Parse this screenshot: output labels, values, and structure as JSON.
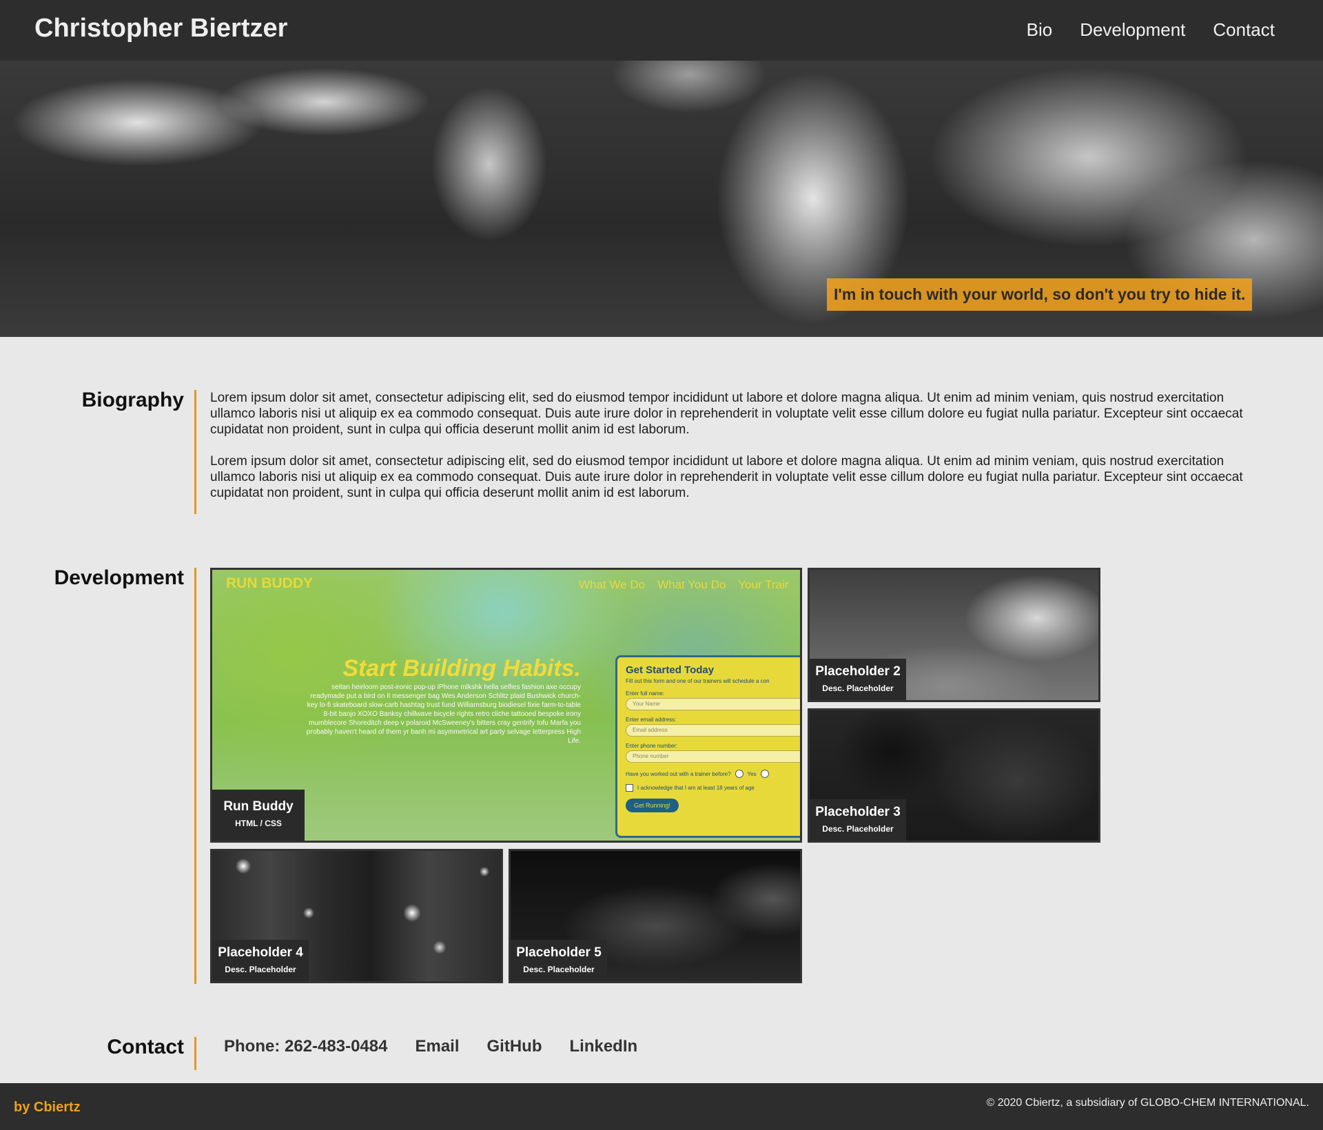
{
  "header": {
    "title": "Christopher Biertzer",
    "nav": [
      "Bio",
      "Development",
      "Contact"
    ]
  },
  "hero": {
    "tagline": "I'm in touch with your world, so don't you try to hide it."
  },
  "biography": {
    "heading": "Biography",
    "paragraphs": [
      "Lorem ipsum dolor sit amet, consectetur adipiscing elit, sed do eiusmod tempor incididunt ut labore et dolore magna aliqua. Ut enim ad minim veniam, quis nostrud exercitation ullamco laboris nisi ut aliquip ex ea commodo consequat. Duis aute irure dolor in reprehenderit in voluptate velit esse cillum dolore eu fugiat nulla pariatur. Excepteur sint occaecat cupidatat non proident, sunt in culpa qui officia deserunt mollit anim id est laborum.",
      "Lorem ipsum dolor sit amet, consectetur adipiscing elit, sed do eiusmod tempor incididunt ut labore et dolore magna aliqua. Ut enim ad minim veniam, quis nostrud exercitation ullamco laboris nisi ut aliquip ex ea commodo consequat. Duis aute irure dolor in reprehenderit in voluptate velit esse cillum dolore eu fugiat nulla pariatur. Excepteur sint occaecat cupidatat non proident, sunt in culpa qui officia deserunt mollit anim id est laborum."
    ]
  },
  "development": {
    "heading": "Development",
    "featured": {
      "title": "Run Buddy",
      "desc": "HTML / CSS",
      "preview": {
        "logo": "RUN BUDDY",
        "nav": [
          "What We Do",
          "What You Do",
          "Your Trair"
        ],
        "headline": "Start Building Habits.",
        "copy": "seitan heirloom post-ironic pop-up iPhone mlkshk hella selfies fashion axe occupy readymade put a bird on it messenger bag Wes Anderson Schlitz plaid Bushwick church-key lo-fi skateboard slow-carb hashtag trust fund Williamsburg biodiesel fixie farm-to-table 8-bit banjo XOXO Banksy chillwave bicycle rights retro cliche tattooed bespoke irony mumblecore Shoreditch deep v polaroid McSweeney's bitters cray gentrify tofu Marfa you probably haven't heard of them yr banh mi asymmetrical art party selvage letterpress High Life.",
        "form_title": "Get Started Today",
        "form_sub": "Fill out this form and one of our trainers will schedule a con",
        "name_label": "Enter full name:",
        "name_placeholder": "Your Name",
        "email_label": "Enter email address:",
        "email_placeholder": "Email address",
        "phone_label": "Enter phone number:",
        "phone_placeholder": "Phone number",
        "question": "Have you worked out with a trainer before?",
        "yes": "Yes",
        "ack": "I acknowledge that I am at least 18 years of age",
        "button": "Get Running!"
      }
    },
    "placeholders": [
      {
        "title": "Placeholder 2",
        "desc": "Desc. Placeholder"
      },
      {
        "title": "Placeholder 3",
        "desc": "Desc. Placeholder"
      },
      {
        "title": "Placeholder 4",
        "desc": "Desc. Placeholder"
      },
      {
        "title": "Placeholder 5",
        "desc": "Desc. Placeholder"
      }
    ]
  },
  "contact": {
    "heading": "Contact",
    "phone": "Phone: 262-483-0484",
    "links": [
      "Email",
      "GitHub",
      "LinkedIn"
    ]
  },
  "footer": {
    "by": "by Cbiertz",
    "copyright": "© 2020 Cbiertz, a subsidiary of GLOBO-CHEM INTERNATIONAL."
  },
  "colors": {
    "accent": "#e8951c",
    "header_bg": "#2d2d2d",
    "page_bg": "#e8e8e8"
  }
}
